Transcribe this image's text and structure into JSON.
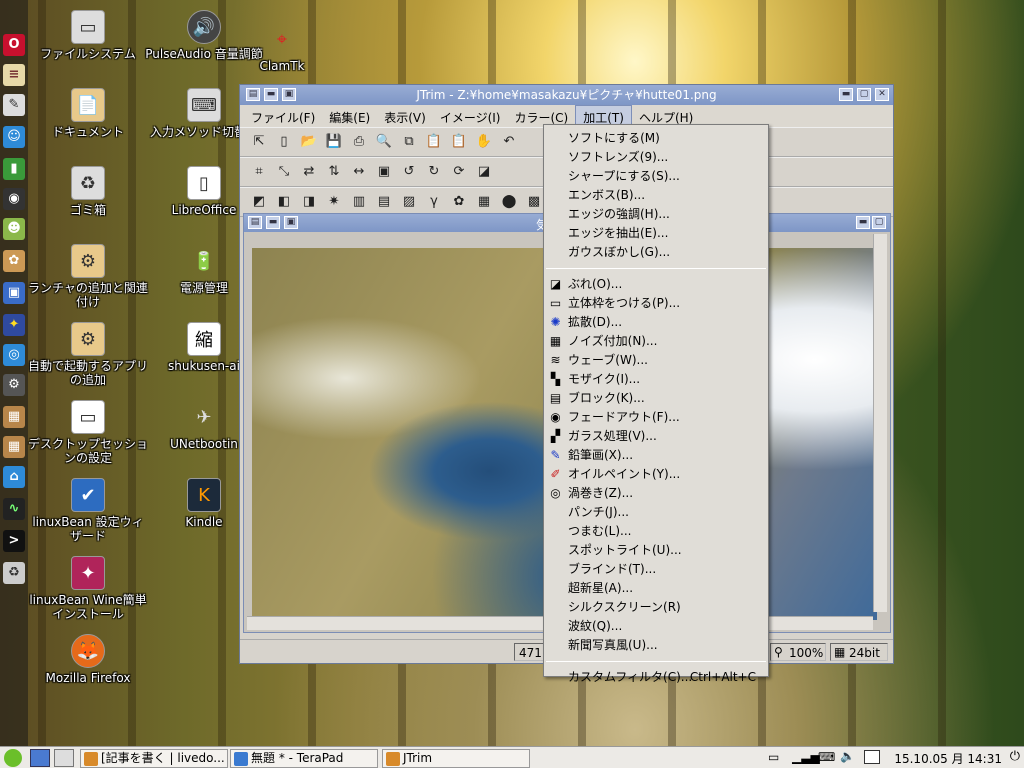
{
  "desktop": {
    "icons": [
      {
        "label": "ファイルシステム",
        "glyph": "▭"
      },
      {
        "label": "ドキュメント",
        "glyph": "📄"
      },
      {
        "label": "ゴミ箱",
        "glyph": "♻"
      },
      {
        "label": "ランチャの追加と関連付け",
        "glyph": "⚙"
      },
      {
        "label": "自動で起動するアプリの追加",
        "glyph": "⚙"
      },
      {
        "label": "デスクトップセッションの設定",
        "glyph": "▭"
      },
      {
        "label": "linuxBean 設定ウィザード",
        "glyph": "✔"
      },
      {
        "label": "linuxBean Wine簡単インストール",
        "glyph": "✦"
      },
      {
        "label": "Mozilla Firefox",
        "glyph": "🦊"
      },
      {
        "label": "PulseAudio 音量調節",
        "glyph": "🔊"
      },
      {
        "label": "入力メソッド切替器",
        "glyph": "⌨"
      },
      {
        "label": "LibreOffice",
        "glyph": "▯"
      },
      {
        "label": "電源管理",
        "glyph": "🔋"
      },
      {
        "label": "shukusen-ai",
        "glyph": "縮"
      },
      {
        "label": "UNetbootin",
        "glyph": "✈"
      },
      {
        "label": "Kindle",
        "glyph": "K"
      },
      {
        "label": "ClamTk",
        "glyph": "⌖"
      }
    ]
  },
  "window": {
    "title": "JTrim - Z:¥home¥masakazu¥ピクチャ¥hutte01.png",
    "menus": [
      "ファイル(F)",
      "編集(E)",
      "表示(V)",
      "イメージ(I)",
      "カラー(C)",
      "加工(T)",
      "ヘルプ(H)"
    ],
    "child_title": "気",
    "status": {
      "pos": "471",
      "zoom": "100%",
      "depth": "24bit"
    }
  },
  "dropdown": {
    "items_top": [
      {
        "label": "ソフトにする(M)",
        "icon": ""
      },
      {
        "label": "ソフトレンズ(9)...",
        "icon": ""
      },
      {
        "label": "シャープにする(S)...",
        "icon": ""
      },
      {
        "label": "エンボス(B)...",
        "icon": ""
      },
      {
        "label": "エッジの強調(H)...",
        "icon": ""
      },
      {
        "label": "エッジを抽出(E)...",
        "icon": ""
      },
      {
        "label": "ガウスぼかし(G)...",
        "icon": ""
      }
    ],
    "items_mid": [
      {
        "label": "ぶれ(O)...",
        "icon": "◪"
      },
      {
        "label": "立体枠をつける(P)...",
        "icon": "▭"
      },
      {
        "label": "拡散(D)...",
        "icon": "✺"
      },
      {
        "label": "ノイズ付加(N)...",
        "icon": "▦"
      },
      {
        "label": "ウェーブ(W)...",
        "icon": "≋"
      },
      {
        "label": "モザイク(I)...",
        "icon": "▚"
      },
      {
        "label": "ブロック(K)...",
        "icon": "▤"
      },
      {
        "label": "フェードアウト(F)...",
        "icon": "◉"
      },
      {
        "label": "ガラス処理(V)...",
        "icon": "▞"
      },
      {
        "label": "鉛筆画(X)...",
        "icon": "✎"
      },
      {
        "label": "オイルペイント(Y)...",
        "icon": "✐"
      },
      {
        "label": "渦巻き(Z)...",
        "icon": "◎"
      },
      {
        "label": "パンチ(J)...",
        "icon": ""
      },
      {
        "label": "つまむ(L)...",
        "icon": ""
      },
      {
        "label": "スポットライト(U)...",
        "icon": ""
      },
      {
        "label": "ブラインド(T)...",
        "icon": ""
      },
      {
        "label": "超新星(A)...",
        "icon": ""
      },
      {
        "label": "シルクスクリーン(R)",
        "icon": ""
      },
      {
        "label": "波紋(Q)...",
        "icon": ""
      },
      {
        "label": "新聞写真風(U)...",
        "icon": ""
      }
    ],
    "custom": {
      "label": "カスタムフィルタ(C)...",
      "shortcut": "Ctrl+Alt+C"
    }
  },
  "taskbar": {
    "tasks": [
      "[記事を書く | livedo...",
      "無題 * - TeraPad",
      "JTrim"
    ],
    "clock": "15.10.05 月 14:31"
  }
}
